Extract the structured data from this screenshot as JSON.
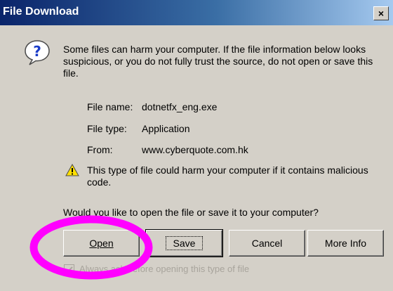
{
  "dialog": {
    "title": "File Download",
    "close_label": "×",
    "message": "Some files can harm your computer. If the file information below looks suspicious, or you do not fully trust the source, do not open or save this file.",
    "file_info": {
      "name_label": "File name:",
      "name_value": "dotnetfx_eng.exe",
      "type_label": "File type:",
      "type_value": "Application",
      "from_label": "From:",
      "from_value": "www.cyberquote.com.hk"
    },
    "warning": "This type of file could harm your computer if it contains malicious code.",
    "prompt": "Would you like to open the file or save it to your computer?",
    "buttons": {
      "open": "Open",
      "save": "Save",
      "cancel": "Cancel",
      "more_info": "More Info"
    },
    "checkbox_label": "Always ask before opening this type of file",
    "checkbox_checked": true
  },
  "annotation": {
    "color": "#ff00ff",
    "target": "open-button"
  },
  "colors": {
    "title_bar_start": "#0a246a",
    "title_bar_end": "#a6caf0",
    "dialog_bg": "#d4d0c8"
  }
}
